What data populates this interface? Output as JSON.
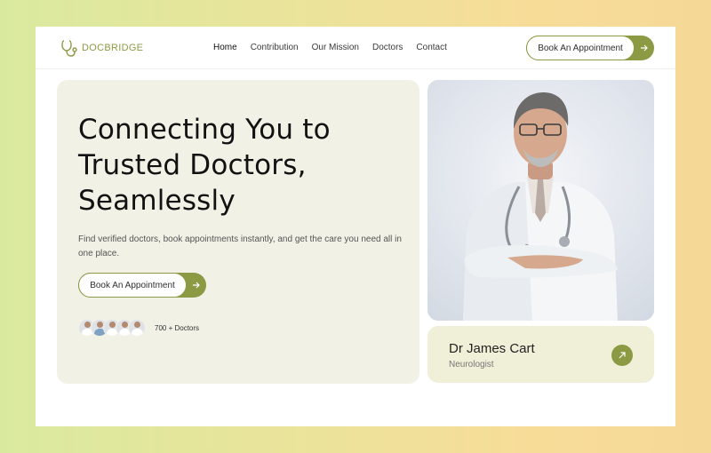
{
  "brand": {
    "name": "DOCBRIDGE",
    "accent": "#8c9a44"
  },
  "nav": {
    "items": [
      "Home",
      "Contribution",
      "Our Mission",
      "Doctors",
      "Contact"
    ],
    "active": "Home"
  },
  "header_cta": {
    "label": "Book An Appointment",
    "icon": "arrow-right-icon"
  },
  "hero": {
    "title": "Connecting You to Trusted Doctors, Seamlessly",
    "subtitle": "Find verified doctors, book appointments instantly, and get the care you need all in one place.",
    "cta_label": "Book An Appointment",
    "cta_icon": "arrow-right-icon",
    "doctor_count": "700 + Doctors"
  },
  "featured_doctor": {
    "name": "Dr James Cart",
    "specialty": "Neurologist",
    "action_icon": "arrow-up-right-icon"
  }
}
